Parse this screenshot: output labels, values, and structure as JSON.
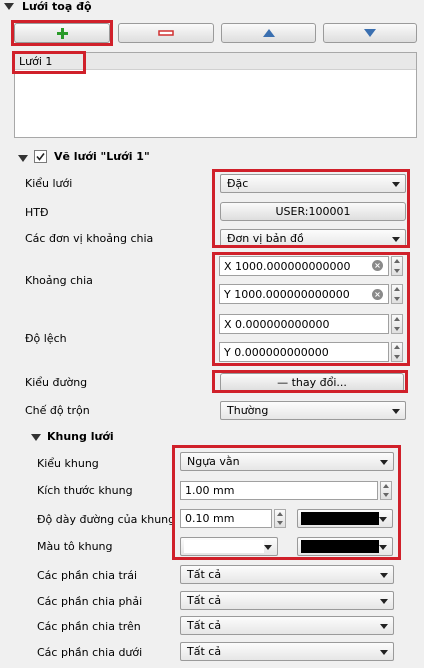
{
  "grid_section": {
    "title": "Lưới toạ độ",
    "items": [
      "Lưới 1"
    ]
  },
  "draw_section": {
    "title": "Vẽ lưới \"Lưới 1\"",
    "checked": true,
    "grid_type_label": "Kiểu lưới",
    "grid_type_value": "Đặc",
    "crs_label": "HTĐ",
    "crs_button": "USER:100001",
    "units_label": "Các đơn vị khoảng chia",
    "units_value": "Đơn vị bản đồ",
    "interval_label": "Khoảng chia",
    "interval_x": "X 1000.000000000000",
    "interval_y": "Y 1000.000000000000",
    "offset_label": "Độ lệch",
    "offset_x": "X 0.000000000000",
    "offset_y": "Y 0.000000000000",
    "line_style_label": "Kiểu đường",
    "line_style_button": "— thay đổi...",
    "blend_label": "Chế độ trộn",
    "blend_value": "Thường"
  },
  "frame_section": {
    "title": "Khung lưới",
    "frame_style_label": "Kiểu khung",
    "frame_style_value": "Ngựa vằn",
    "frame_size_label": "Kích thước khung",
    "frame_size_value": "1.00 mm",
    "frame_line_label": "Độ dày đường của khung",
    "frame_line_value": "0.10 mm",
    "frame_fill_label": "Màu tô khung",
    "left_label": "Các phần chia trái",
    "left_value": "Tất cả",
    "right_label": "Các phần chia phải",
    "right_value": "Tất cả",
    "top_label": "Các phần chia trên",
    "top_value": "Tất cả",
    "bottom_label": "Các phần chia dưới",
    "bottom_value": "Tất cả"
  },
  "colors": {
    "highlight": "#d0202a",
    "fill1": "#ffffff",
    "fill2": "#000000",
    "add": "#2a9a2a",
    "remove": "#d03030",
    "arrow": "#3a6fb0"
  },
  "icons": [
    "collapse-arrow-icon",
    "plus-icon",
    "minus-icon",
    "up-arrow-icon",
    "down-arrow-icon",
    "checkbox-icon",
    "clear-icon"
  ]
}
